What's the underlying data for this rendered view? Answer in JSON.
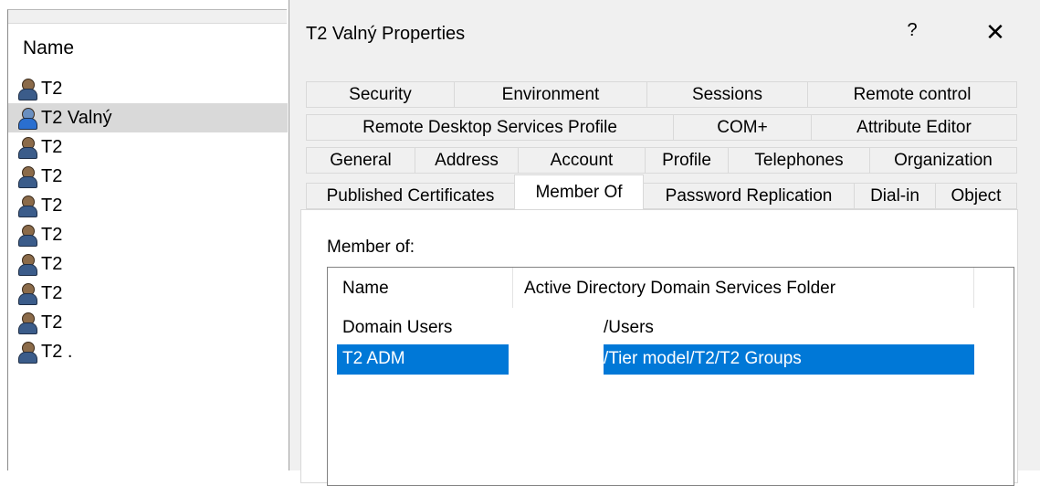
{
  "left_panel": {
    "column_header": "Name",
    "users": [
      {
        "label": "T2",
        "selected": false
      },
      {
        "label": "T2 Valný",
        "selected": true
      },
      {
        "label": "T2",
        "selected": false
      },
      {
        "label": "T2",
        "selected": false
      },
      {
        "label": "T2",
        "selected": false
      },
      {
        "label": "T2",
        "selected": false
      },
      {
        "label": "T2",
        "selected": false
      },
      {
        "label": "T2",
        "selected": false
      },
      {
        "label": "T2",
        "selected": false
      },
      {
        "label": "T2 .",
        "selected": false
      }
    ]
  },
  "dialog": {
    "title": "T2 Valný Properties",
    "help_label": "?",
    "close_label": "✕",
    "tabs": {
      "row1": [
        "Security",
        "Environment",
        "Sessions",
        "Remote control"
      ],
      "row2": [
        "Remote Desktop Services Profile",
        "COM+",
        "Attribute Editor"
      ],
      "row3": [
        "General",
        "Address",
        "Account",
        "Profile",
        "Telephones",
        "Organization"
      ],
      "row4": [
        "Published Certificates",
        "Member Of",
        "Password Replication",
        "Dial-in",
        "Object"
      ]
    },
    "active_tab": "Member Of",
    "member_of": {
      "label": "Member of:",
      "columns": [
        "Name",
        "Active Directory Domain Services Folder"
      ],
      "rows": [
        {
          "name": "Domain Users",
          "folder": "/Users",
          "selected": false
        },
        {
          "name": "T2 ADM",
          "folder": "/Tier model/T2/T2 Groups",
          "selected": true
        }
      ]
    }
  },
  "colors": {
    "selection": "#0078d7",
    "dialog_bg": "#f0f0f0",
    "left_selected_bg": "#d9d9d9"
  }
}
